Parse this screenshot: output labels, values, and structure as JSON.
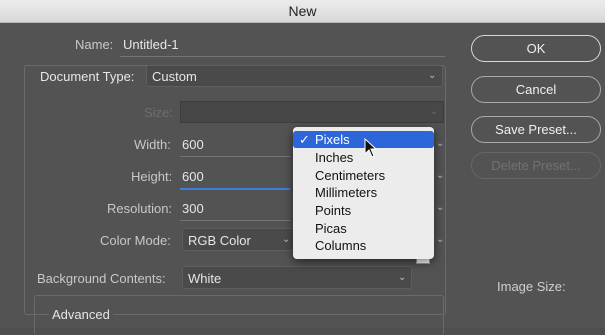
{
  "window": {
    "title": "New"
  },
  "form": {
    "name_label": "Name:",
    "name_value": "Untitled-1",
    "doctype_label": "Document Type:",
    "doctype_value": "Custom",
    "size_label": "Size:",
    "width_label": "Width:",
    "width_value": "600",
    "height_label": "Height:",
    "height_value": "600",
    "resolution_label": "Resolution:",
    "resolution_value": "300",
    "colormode_label": "Color Mode:",
    "colormode_value": "RGB Color",
    "bg_label": "Background Contents:",
    "bg_value": "White",
    "bg_swatch_color": "#ffffff",
    "advanced_label": "Advanced"
  },
  "buttons": {
    "ok": "OK",
    "cancel": "Cancel",
    "save_preset": "Save Preset...",
    "delete_preset": "Delete Preset..."
  },
  "image_size_label": "Image Size:",
  "unit_menu": {
    "selected": "Pixels",
    "check": "✓",
    "items": [
      "Pixels",
      "Inches",
      "Centimeters",
      "Millimeters",
      "Points",
      "Picas",
      "Columns"
    ]
  },
  "colors": {
    "highlight": "#2d66d8"
  }
}
